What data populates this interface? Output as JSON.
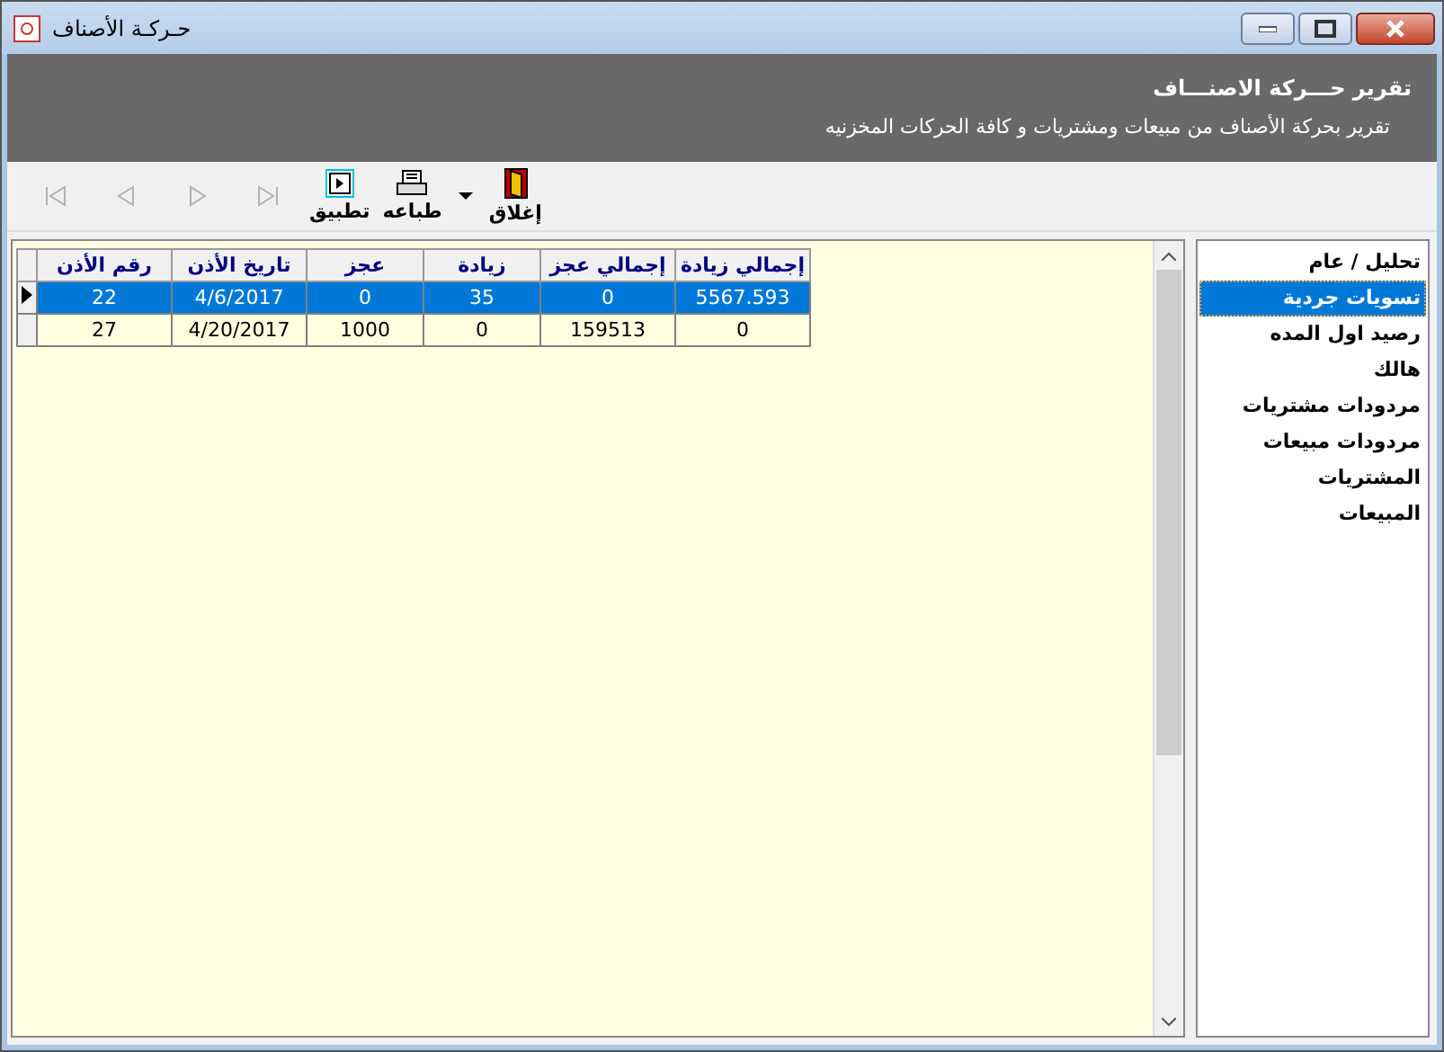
{
  "window": {
    "title": "حـركـة الأصناف"
  },
  "header": {
    "title": "تقرير حـــركة الاصنـــاف",
    "subtitle": "تقرير بحركة الأصناف من مبيعات ومشتريات و كافة الحركات المخزنيه"
  },
  "toolbar": {
    "nav_buttons": [
      {
        "kind": "first",
        "disabled": true
      },
      {
        "kind": "prev",
        "disabled": true
      },
      {
        "kind": "next",
        "disabled": true
      },
      {
        "kind": "last",
        "disabled": true
      }
    ],
    "actions": [
      {
        "kind": "close",
        "label": "إغلاق"
      },
      {
        "kind": "dropdown"
      },
      {
        "kind": "print",
        "label": "طباعه"
      },
      {
        "kind": "apply",
        "label": "تطبيق"
      }
    ]
  },
  "table": {
    "columns": [
      "إجمالي زيادة",
      "إجمالي عجز",
      "زيادة",
      "عجز",
      "تاريخ الأذن",
      "رقم الأذن"
    ],
    "rows": [
      {
        "selected": true,
        "cells": [
          "5567.593",
          "0",
          "35",
          "0",
          "4/6/2017",
          "22"
        ]
      },
      {
        "selected": false,
        "cells": [
          "0",
          "159513",
          "0",
          "1000",
          "4/20/2017",
          "27"
        ]
      }
    ]
  },
  "sidebar": {
    "items": [
      {
        "label": "تحليل / عام",
        "selected": false
      },
      {
        "label": "تسويات جردية",
        "selected": true
      },
      {
        "label": "رصيد اول المده",
        "selected": false
      },
      {
        "label": "هالك",
        "selected": false
      },
      {
        "label": "مردودات مشتريات",
        "selected": false
      },
      {
        "label": "مردودات مبيعات",
        "selected": false
      },
      {
        "label": "المشتريات",
        "selected": false
      },
      {
        "label": "المبيعات",
        "selected": false
      }
    ]
  }
}
